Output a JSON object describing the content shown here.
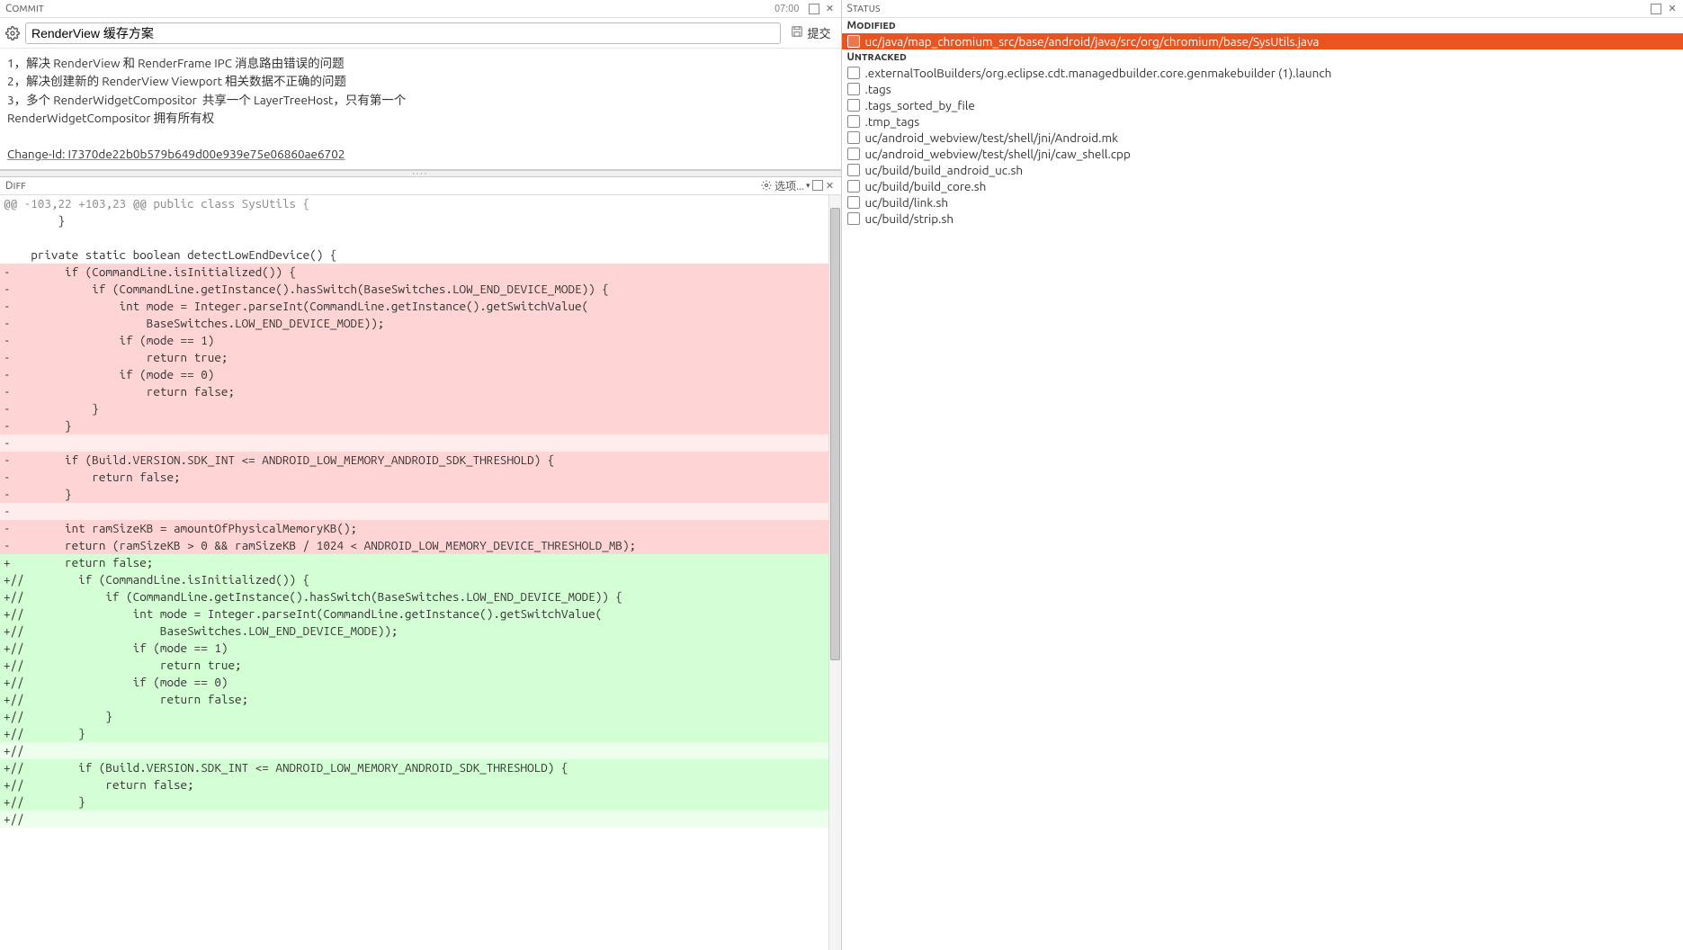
{
  "commit_panel": {
    "title": "Commit",
    "time": "07:00",
    "subject": "RenderView 缓存方案",
    "submit_label": "提交",
    "message_lines": [
      "1，解决 RenderView 和 RenderFrame IPC 消息路由错误的问题",
      "2，解决创建新的 RenderView Viewport 相关数据不正确的问题",
      "3，多个 RenderWidgetCompositor  共享一个 LayerTreeHost，只有第一个",
      "RenderWidgetCompositor 拥有所有权",
      "",
      "Change-Id: I7370de22b0b579b649d00e939e75e06860ae6702"
    ]
  },
  "diff_panel": {
    "title": "Diff",
    "options_label": "选项...",
    "lines": [
      {
        "t": "hunk",
        "c": "@@ -103,22 +103,23 @@ public class SysUtils {"
      },
      {
        "t": "ctx",
        "c": "        }"
      },
      {
        "t": "ctx",
        "c": ""
      },
      {
        "t": "ctx",
        "c": "    private static boolean detectLowEndDevice() {"
      },
      {
        "t": "del",
        "c": "-        if (CommandLine.isInitialized()) {"
      },
      {
        "t": "del",
        "c": "-            if (CommandLine.getInstance().hasSwitch(BaseSwitches.LOW_END_DEVICE_MODE)) {"
      },
      {
        "t": "del",
        "c": "-                int mode = Integer.parseInt(CommandLine.getInstance().getSwitchValue("
      },
      {
        "t": "del",
        "c": "-                    BaseSwitches.LOW_END_DEVICE_MODE));"
      },
      {
        "t": "del",
        "c": "-                if (mode == 1)"
      },
      {
        "t": "del",
        "c": "-                    return true;"
      },
      {
        "t": "del",
        "c": "-                if (mode == 0)"
      },
      {
        "t": "del",
        "c": "-                    return false;"
      },
      {
        "t": "del",
        "c": "-            }"
      },
      {
        "t": "del",
        "c": "-        }"
      },
      {
        "t": "del-light",
        "c": "-"
      },
      {
        "t": "del",
        "c": "-        if (Build.VERSION.SDK_INT <= ANDROID_LOW_MEMORY_ANDROID_SDK_THRESHOLD) {"
      },
      {
        "t": "del",
        "c": "-            return false;"
      },
      {
        "t": "del",
        "c": "-        }"
      },
      {
        "t": "del-light",
        "c": "-"
      },
      {
        "t": "del",
        "c": "-        int ramSizeKB = amountOfPhysicalMemoryKB();"
      },
      {
        "t": "del",
        "c": "-        return (ramSizeKB > 0 && ramSizeKB / 1024 < ANDROID_LOW_MEMORY_DEVICE_THRESHOLD_MB);"
      },
      {
        "t": "add",
        "c": "+        return false;"
      },
      {
        "t": "add",
        "c": "+//        if (CommandLine.isInitialized()) {"
      },
      {
        "t": "add",
        "c": "+//            if (CommandLine.getInstance().hasSwitch(BaseSwitches.LOW_END_DEVICE_MODE)) {"
      },
      {
        "t": "add",
        "c": "+//                int mode = Integer.parseInt(CommandLine.getInstance().getSwitchValue("
      },
      {
        "t": "add",
        "c": "+//                    BaseSwitches.LOW_END_DEVICE_MODE));"
      },
      {
        "t": "add",
        "c": "+//                if (mode == 1)"
      },
      {
        "t": "add",
        "c": "+//                    return true;"
      },
      {
        "t": "add",
        "c": "+//                if (mode == 0)"
      },
      {
        "t": "add",
        "c": "+//                    return false;"
      },
      {
        "t": "add",
        "c": "+//            }"
      },
      {
        "t": "add",
        "c": "+//        }"
      },
      {
        "t": "add-light",
        "c": "+//"
      },
      {
        "t": "add",
        "c": "+//        if (Build.VERSION.SDK_INT <= ANDROID_LOW_MEMORY_ANDROID_SDK_THRESHOLD) {"
      },
      {
        "t": "add",
        "c": "+//            return false;"
      },
      {
        "t": "add",
        "c": "+//        }"
      },
      {
        "t": "add-light",
        "c": "+//"
      }
    ]
  },
  "status_panel": {
    "title": "Status",
    "modified_label": "Modified",
    "untracked_label": "Untracked",
    "modified_files": [
      {
        "path": "uc/java/map_chromium_src/base/android/java/src/org/chromium/base/SysUtils.java",
        "selected": true
      }
    ],
    "untracked_files": [
      {
        "path": ".externalToolBuilders/org.eclipse.cdt.managedbuilder.core.genmakebuilder (1).launch"
      },
      {
        "path": ".tags"
      },
      {
        "path": ".tags_sorted_by_file"
      },
      {
        "path": ".tmp_tags"
      },
      {
        "path": "uc/android_webview/test/shell/jni/Android.mk"
      },
      {
        "path": "uc/android_webview/test/shell/jni/caw_shell.cpp"
      },
      {
        "path": "uc/build/build_android_uc.sh"
      },
      {
        "path": "uc/build/build_core.sh"
      },
      {
        "path": "uc/build/link.sh"
      },
      {
        "path": "uc/build/strip.sh"
      }
    ]
  }
}
